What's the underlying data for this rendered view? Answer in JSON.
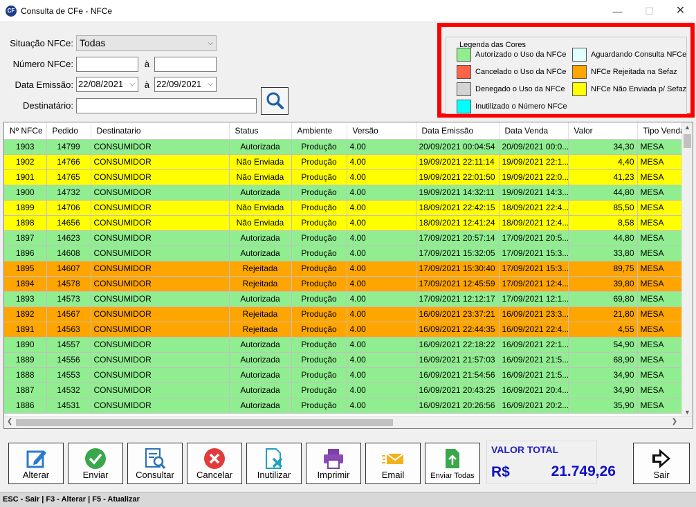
{
  "window": {
    "title": "Consulta de CFe - NFCe",
    "app_icon": "CF"
  },
  "filters": {
    "situacao_label": "Situação NFCe:",
    "situacao_value": "Todas",
    "numero_label": "Número NFCe:",
    "numero_from": "",
    "numero_sep": "à",
    "numero_to": "",
    "data_label": "Data Emissão:",
    "data_from": "22/08/2021",
    "data_sep": "à",
    "data_to": "22/09/2021",
    "destinatario_label": "Destinatário:",
    "destinatario_value": ""
  },
  "legend": {
    "title": "Legenda das Cores",
    "items": [
      {
        "label": "Autorizado o Uso da NFCe",
        "color": "#90ee90"
      },
      {
        "label": "Cancelado o Uso da NFCe",
        "color": "#ff6347"
      },
      {
        "label": "Denegado o Uso da NFCe",
        "color": "#d3d3d3"
      },
      {
        "label": "Inutilizado o Número NFCe",
        "color": "#00ffff"
      },
      {
        "label": "Aguardando Consulta NFCe",
        "color": "#e0ffff"
      },
      {
        "label": "NFCe Rejeitada na Sefaz",
        "color": "#ffa500"
      },
      {
        "label": "NFCe Não Enviada p/ Sefaz",
        "color": "#ffff00"
      }
    ]
  },
  "grid": {
    "columns": [
      "Nº NFCe",
      "Pedido",
      "Destinatario",
      "Status",
      "Ambiente",
      "Versão",
      "Data Emissão",
      "Data Venda",
      "Valor",
      "Tipo Venda"
    ],
    "rows": [
      {
        "nfce": "1903",
        "pedido": "14799",
        "dest": "CONSUMIDOR",
        "status": "Autorizada",
        "amb": "Produção",
        "versao": "4.00",
        "emissao": "20/09/2021 00:04:54",
        "venda": "20/09/2021 00:0...",
        "valor": "34,30",
        "tipo": "MESA",
        "color": "#90ee90"
      },
      {
        "nfce": "1902",
        "pedido": "14766",
        "dest": "CONSUMIDOR",
        "status": "Não Enviada",
        "amb": "Produção",
        "versao": "4.00",
        "emissao": "19/09/2021 22:11:14",
        "venda": "19/09/2021 22:1...",
        "valor": "4,40",
        "tipo": "MESA",
        "color": "#ffff00"
      },
      {
        "nfce": "1901",
        "pedido": "14765",
        "dest": "CONSUMIDOR",
        "status": "Não Enviada",
        "amb": "Produção",
        "versao": "4.00",
        "emissao": "19/09/2021 22:01:50",
        "venda": "19/09/2021 22:0...",
        "valor": "41,23",
        "tipo": "MESA",
        "color": "#ffff00"
      },
      {
        "nfce": "1900",
        "pedido": "14732",
        "dest": "CONSUMIDOR",
        "status": "Autorizada",
        "amb": "Produção",
        "versao": "4.00",
        "emissao": "19/09/2021 14:32:11",
        "venda": "19/09/2021 14:3...",
        "valor": "44,80",
        "tipo": "MESA",
        "color": "#90ee90"
      },
      {
        "nfce": "1899",
        "pedido": "14706",
        "dest": "CONSUMIDOR",
        "status": "Não Enviada",
        "amb": "Produção",
        "versao": "4.00",
        "emissao": "18/09/2021 22:42:15",
        "venda": "18/09/2021 22:4...",
        "valor": "85,50",
        "tipo": "MESA",
        "color": "#ffff00"
      },
      {
        "nfce": "1898",
        "pedido": "14656",
        "dest": "CONSUMIDOR",
        "status": "Não Enviada",
        "amb": "Produção",
        "versao": "4.00",
        "emissao": "18/09/2021 12:41:24",
        "venda": "18/09/2021 12:4...",
        "valor": "8,58",
        "tipo": "MESA",
        "color": "#ffff00"
      },
      {
        "nfce": "1897",
        "pedido": "14623",
        "dest": "CONSUMIDOR",
        "status": "Autorizada",
        "amb": "Produção",
        "versao": "4.00",
        "emissao": "17/09/2021 20:57:14",
        "venda": "17/09/2021 20:5...",
        "valor": "44,80",
        "tipo": "MESA",
        "color": "#90ee90"
      },
      {
        "nfce": "1896",
        "pedido": "14608",
        "dest": "CONSUMIDOR",
        "status": "Autorizada",
        "amb": "Produção",
        "versao": "4.00",
        "emissao": "17/09/2021 15:32:05",
        "venda": "17/09/2021 15:3...",
        "valor": "33,80",
        "tipo": "MESA",
        "color": "#90ee90"
      },
      {
        "nfce": "1895",
        "pedido": "14607",
        "dest": "CONSUMIDOR",
        "status": "Rejeitada",
        "amb": "Produção",
        "versao": "4.00",
        "emissao": "17/09/2021 15:30:40",
        "venda": "17/09/2021 15:3...",
        "valor": "89,75",
        "tipo": "MESA",
        "color": "#ffa500"
      },
      {
        "nfce": "1894",
        "pedido": "14578",
        "dest": "CONSUMIDOR",
        "status": "Rejeitada",
        "amb": "Produção",
        "versao": "4.00",
        "emissao": "17/09/2021 12:45:59",
        "venda": "17/09/2021 12:4...",
        "valor": "39,80",
        "tipo": "MESA",
        "color": "#ffa500"
      },
      {
        "nfce": "1893",
        "pedido": "14573",
        "dest": "CONSUMIDOR",
        "status": "Autorizada",
        "amb": "Produção",
        "versao": "4.00",
        "emissao": "17/09/2021 12:12:17",
        "venda": "17/09/2021 12:1...",
        "valor": "69,80",
        "tipo": "MESA",
        "color": "#90ee90"
      },
      {
        "nfce": "1892",
        "pedido": "14567",
        "dest": "CONSUMIDOR",
        "status": "Rejeitada",
        "amb": "Produção",
        "versao": "4.00",
        "emissao": "16/09/2021 23:37:21",
        "venda": "16/09/2021 23:3...",
        "valor": "21,80",
        "tipo": "MESA",
        "color": "#ffa500"
      },
      {
        "nfce": "1891",
        "pedido": "14563",
        "dest": "CONSUMIDOR",
        "status": "Rejeitada",
        "amb": "Produção",
        "versao": "4.00",
        "emissao": "16/09/2021 22:44:35",
        "venda": "16/09/2021 22:4...",
        "valor": "4,55",
        "tipo": "MESA",
        "color": "#ffa500"
      },
      {
        "nfce": "1890",
        "pedido": "14557",
        "dest": "CONSUMIDOR",
        "status": "Autorizada",
        "amb": "Produção",
        "versao": "4.00",
        "emissao": "16/09/2021 22:18:22",
        "venda": "16/09/2021 22:1...",
        "valor": "54,90",
        "tipo": "MESA",
        "color": "#90ee90"
      },
      {
        "nfce": "1889",
        "pedido": "14556",
        "dest": "CONSUMIDOR",
        "status": "Autorizada",
        "amb": "Produção",
        "versao": "4.00",
        "emissao": "16/09/2021 21:57:03",
        "venda": "16/09/2021 21:5...",
        "valor": "68,90",
        "tipo": "MESA",
        "color": "#90ee90"
      },
      {
        "nfce": "1888",
        "pedido": "14553",
        "dest": "CONSUMIDOR",
        "status": "Autorizada",
        "amb": "Produção",
        "versao": "4.00",
        "emissao": "16/09/2021 21:54:56",
        "venda": "16/09/2021 21:5...",
        "valor": "34,90",
        "tipo": "MESA",
        "color": "#90ee90"
      },
      {
        "nfce": "1887",
        "pedido": "14532",
        "dest": "CONSUMIDOR",
        "status": "Autorizada",
        "amb": "Produção",
        "versao": "4.00",
        "emissao": "16/09/2021 20:43:25",
        "venda": "16/09/2021 20:4...",
        "valor": "34,90",
        "tipo": "MESA",
        "color": "#90ee90"
      },
      {
        "nfce": "1886",
        "pedido": "14531",
        "dest": "CONSUMIDOR",
        "status": "Autorizada",
        "amb": "Produção",
        "versao": "4.00",
        "emissao": "16/09/2021 20:26:56",
        "venda": "16/09/2021 20:2...",
        "valor": "35,90",
        "tipo": "MESA",
        "color": "#90ee90"
      }
    ]
  },
  "toolbar": {
    "alterar": "Alterar",
    "enviar": "Enviar",
    "consultar": "Consultar",
    "cancelar": "Cancelar",
    "inutilizar": "Inutilizar",
    "imprimir": "Imprimir",
    "email": "Email",
    "enviar_todas": "Enviar Todas",
    "sair": "Sair"
  },
  "total": {
    "label": "VALOR TOTAL",
    "currency": "R$",
    "value": "21.749,26"
  },
  "statusbar": {
    "text": "ESC - Sair | F3 - Alterar  |  F5 - Atualizar"
  }
}
